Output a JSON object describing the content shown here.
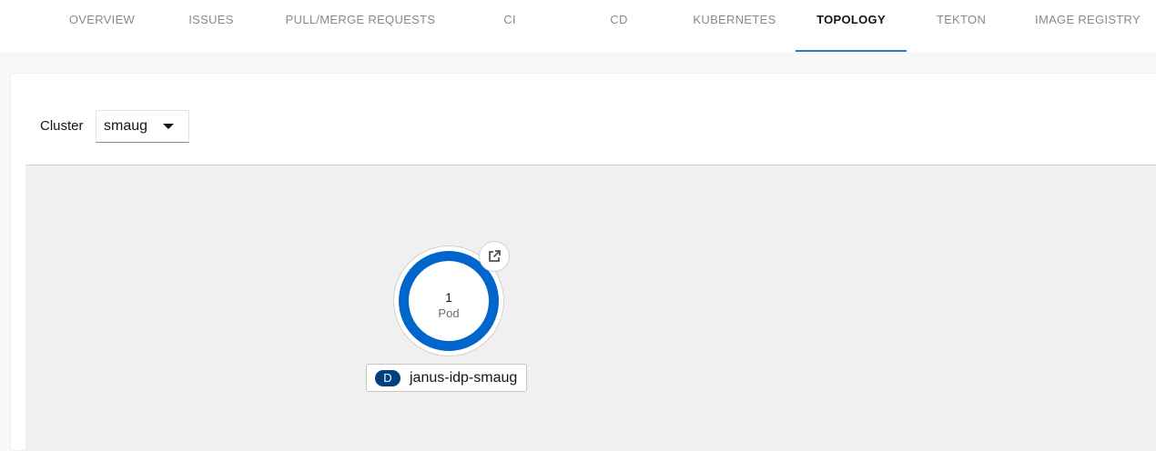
{
  "tabs": [
    {
      "label": "OVERVIEW",
      "active": false
    },
    {
      "label": "ISSUES",
      "active": false
    },
    {
      "label": "PULL/MERGE REQUESTS",
      "active": false
    },
    {
      "label": "CI",
      "active": false
    },
    {
      "label": "CD",
      "active": false
    },
    {
      "label": "KUBERNETES",
      "active": false
    },
    {
      "label": "TOPOLOGY",
      "active": true
    },
    {
      "label": "TEKTON",
      "active": false
    },
    {
      "label": "IMAGE REGISTRY",
      "active": false
    }
  ],
  "filter": {
    "cluster_label": "Cluster",
    "cluster_value": "smaug"
  },
  "topology": {
    "node": {
      "pod_count": "1",
      "pod_label": "Pod",
      "badge": "D",
      "name": "janus-idp-smaug",
      "ring_color": "#0066cc",
      "badge_color": "#004080",
      "link_icon": "external-link-icon"
    }
  },
  "colors": {
    "active_tab_underline": "#2b78c5",
    "canvas_background": "#f0f0f0"
  }
}
